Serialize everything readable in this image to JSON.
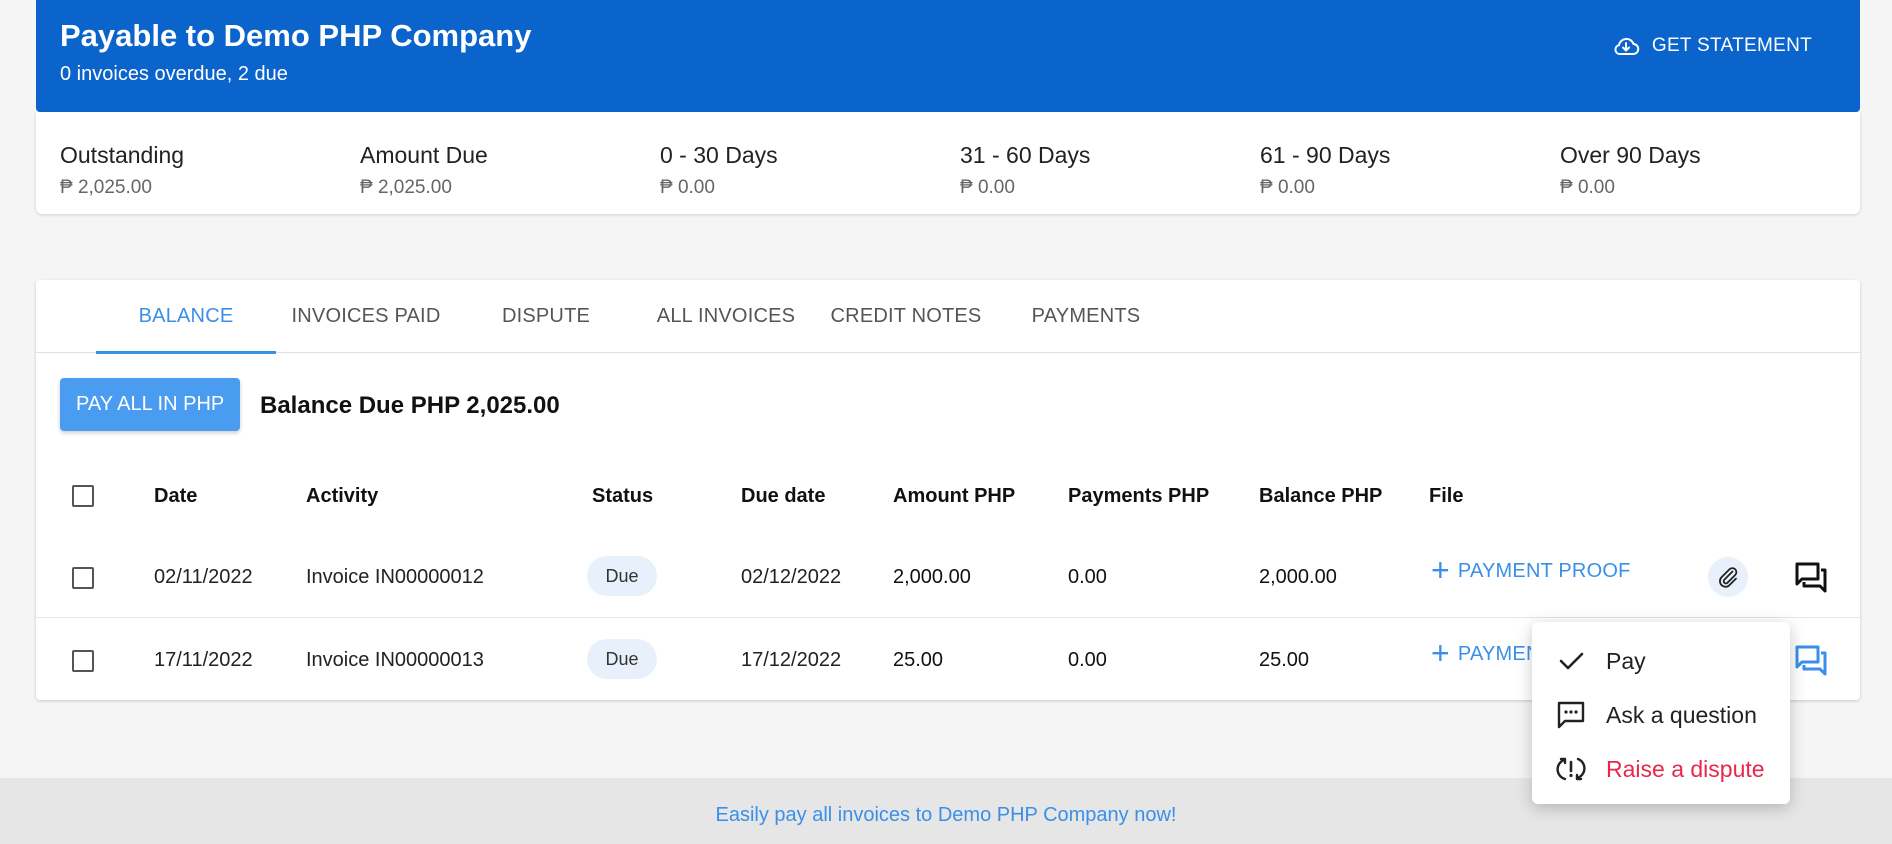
{
  "header": {
    "title": "Payable to Demo PHP Company",
    "subtitle": "0 invoices overdue, 2 due",
    "statement_label": "GET STATEMENT"
  },
  "summary": [
    {
      "label": "Outstanding",
      "value": "₱ 2,025.00"
    },
    {
      "label": "Amount Due",
      "value": "₱ 2,025.00"
    },
    {
      "label": "0 - 30 Days",
      "value": "₱ 0.00"
    },
    {
      "label": "31 - 60 Days",
      "value": "₱ 0.00"
    },
    {
      "label": "61 - 90 Days",
      "value": "₱ 0.00"
    },
    {
      "label": "Over 90 Days",
      "value": "₱ 0.00"
    }
  ],
  "tabs": [
    {
      "label": "BALANCE",
      "active": true
    },
    {
      "label": "INVOICES PAID"
    },
    {
      "label": "DISPUTE"
    },
    {
      "label": "ALL INVOICES"
    },
    {
      "label": "CREDIT NOTES"
    },
    {
      "label": "PAYMENTS"
    }
  ],
  "balance": {
    "pay_all_label": "PAY ALL IN PHP",
    "balance_due": "Balance Due PHP 2,025.00"
  },
  "table": {
    "columns": [
      "Date",
      "Activity",
      "Status",
      "Due date",
      "Amount PHP",
      "Payments PHP",
      "Balance PHP",
      "File"
    ],
    "rows": [
      {
        "date": "02/11/2022",
        "activity": "Invoice IN00000012",
        "status": "Due",
        "due_date": "02/12/2022",
        "amount": "2,000.00",
        "payments": "0.00",
        "balance": "2,000.00",
        "file_label": "PAYMENT PROOF"
      },
      {
        "date": "17/11/2022",
        "activity": "Invoice IN00000013",
        "status": "Due",
        "due_date": "17/12/2022",
        "amount": "25.00",
        "payments": "0.00",
        "balance": "25.00",
        "file_label": "PAYMENT PROOF"
      }
    ]
  },
  "menu": {
    "items": [
      {
        "label": "Pay",
        "icon": "check-icon"
      },
      {
        "label": "Ask a question",
        "icon": "chat-dots-icon"
      },
      {
        "label": "Raise a dispute",
        "icon": "dispute-icon"
      }
    ]
  },
  "footer": {
    "text": "Easily pay all invoices to Demo PHP Company now!"
  },
  "colors": {
    "header_bg": "#0b64cc",
    "accent": "#3b8fe8",
    "badge_bg": "#e8f1fb",
    "danger": "#e8274b"
  }
}
